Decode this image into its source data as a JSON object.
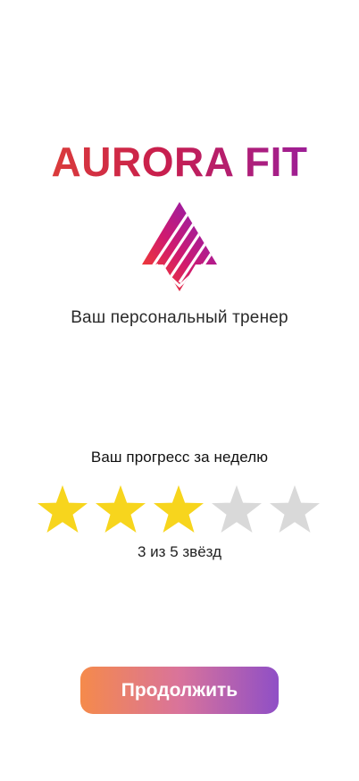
{
  "app": {
    "title": "AURORA FIT",
    "tagline": "Ваш персональный тренер",
    "logo_icon": "aurora-logo-icon",
    "brand_gradient": [
      "#e34a33",
      "#c81e4d",
      "#8e1fb1"
    ]
  },
  "progress": {
    "title": "Ваш прогресс за неделю",
    "rating": 3,
    "max_rating": 5,
    "rating_text": "3 из 5 звёзд",
    "star_icon": "star-icon",
    "filled_color": "#f7d51d",
    "empty_color": "#d9d9d9"
  },
  "actions": {
    "continue_label": "Продолжить",
    "button_gradient": [
      "#f58a4b",
      "#d9739b",
      "#8f4fc6"
    ]
  }
}
